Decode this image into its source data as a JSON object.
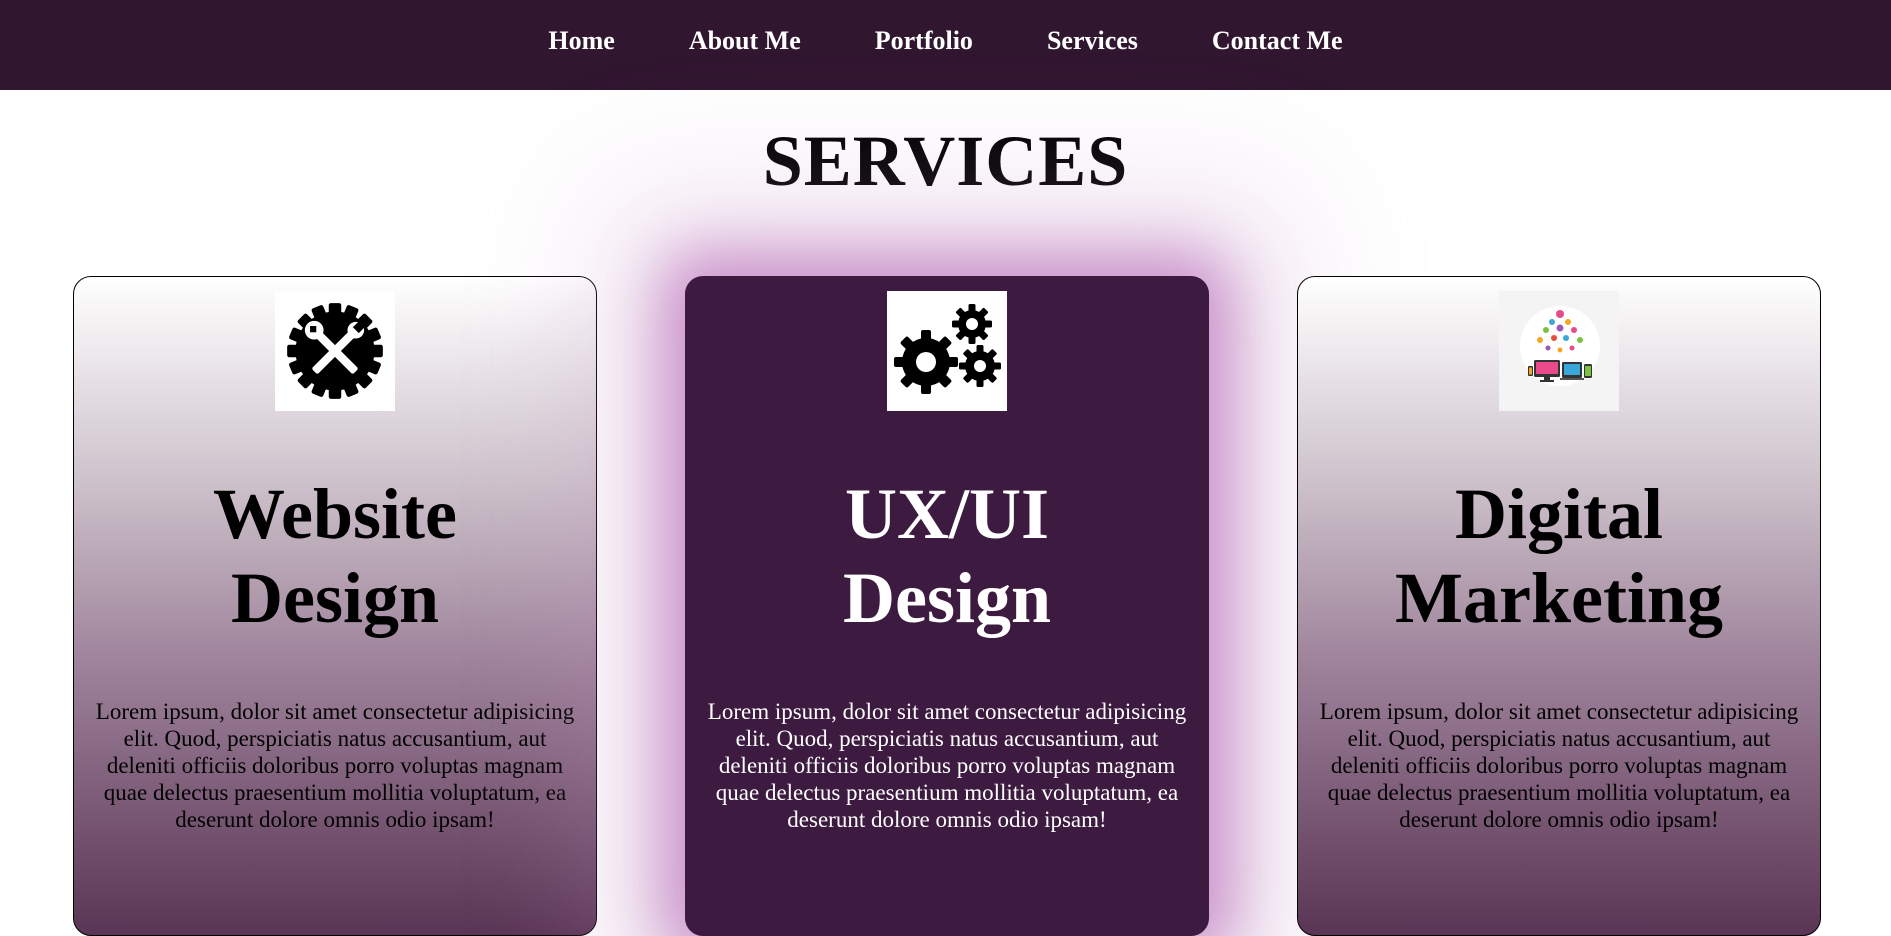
{
  "nav": {
    "items": [
      {
        "label": "Home"
      },
      {
        "label": "About Me"
      },
      {
        "label": "Portfolio"
      },
      {
        "label": "Services"
      },
      {
        "label": "Contact Me"
      }
    ]
  },
  "main": {
    "title": "SERVICES",
    "cards": [
      {
        "icon": "wrench-gear-icon",
        "title_line1": "Website",
        "title_line2": "Design",
        "text": "Lorem ipsum, dolor sit amet consectetur adipisicing elit. Quod, perspiciatis natus accusantium, aut deleniti officiis doloribus porro voluptas magnam quae delectus praesentium mollitia voluptatum, ea deserunt dolore omnis odio ipsam!"
      },
      {
        "icon": "gears-icon",
        "title_line1": "UX/UI",
        "title_line2": "Design",
        "text": "Lorem ipsum, dolor sit amet consectetur adipisicing elit. Quod, perspiciatis natus accusantium, aut deleniti officiis doloribus porro voluptas magnam quae delectus praesentium mollitia voluptatum, ea deserunt dolore omnis odio ipsam!"
      },
      {
        "icon": "digital-marketing-icon",
        "title_line1": "Digital",
        "title_line2": "Marketing",
        "text": "Lorem ipsum, dolor sit amet consectetur adipisicing elit. Quod, perspiciatis natus accusantium, aut deleniti officiis doloribus porro voluptas magnam quae delectus praesentium mollitia voluptatum, ea deserunt dolore omnis odio ipsam!"
      }
    ]
  },
  "colors": {
    "navbar_bg": "#311630",
    "featured_card_bg": "#3d1a40",
    "glow": "#be78be"
  }
}
